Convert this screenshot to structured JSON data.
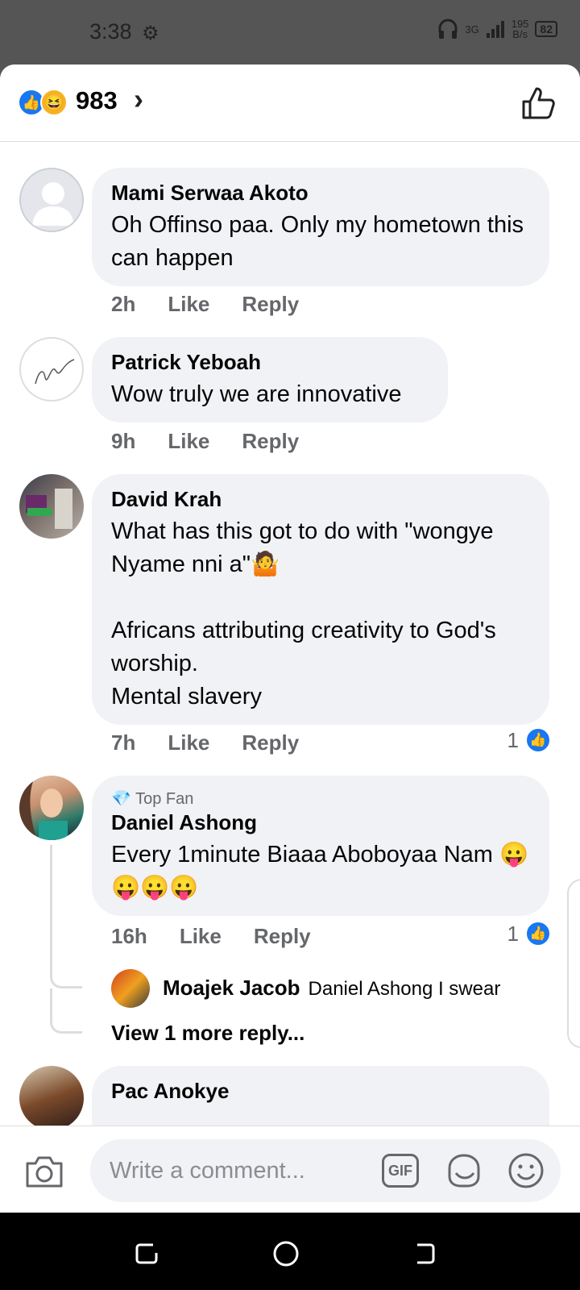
{
  "status": {
    "time": "3:38",
    "net_type": "3G",
    "speed_value": "195",
    "speed_unit": "B/s",
    "battery": "82"
  },
  "header": {
    "reaction_count": "983"
  },
  "comments": [
    {
      "name": "Mami Serwaa Akoto",
      "text": "Oh Offinso paa. Only my hometown this can happen",
      "time": "2h",
      "like": "Like",
      "reply": "Reply"
    },
    {
      "name": "Patrick Yeboah",
      "text": "Wow truly we are innovative",
      "time": "9h",
      "like": "Like",
      "reply": "Reply"
    },
    {
      "name": "David Krah",
      "text": "What has this got to do with \"wongye Nyame nni a\"🤷\n\nAfricans attributing creativity to God's worship.\nMental slavery",
      "time": "7h",
      "like": "Like",
      "reply": "Reply",
      "like_count": "1"
    },
    {
      "badge": "Top Fan",
      "name": "Daniel Ashong",
      "text": "Every 1minute Biaaa Aboboyaa Nam 😛😛😛😛",
      "time": "16h",
      "like": "Like",
      "reply": "Reply",
      "like_count": "1"
    },
    {
      "name": "Pac Anokye"
    }
  ],
  "reply_preview": {
    "name": "Moajek Jacob",
    "text": "Daniel Ashong I swear",
    "view_more": "View 1 more reply..."
  },
  "composer": {
    "placeholder": "Write a comment...",
    "gif_label": "GIF"
  },
  "colors": {
    "accent": "#1877f2",
    "bubble": "#f0f2f5",
    "meta": "#65676b"
  }
}
